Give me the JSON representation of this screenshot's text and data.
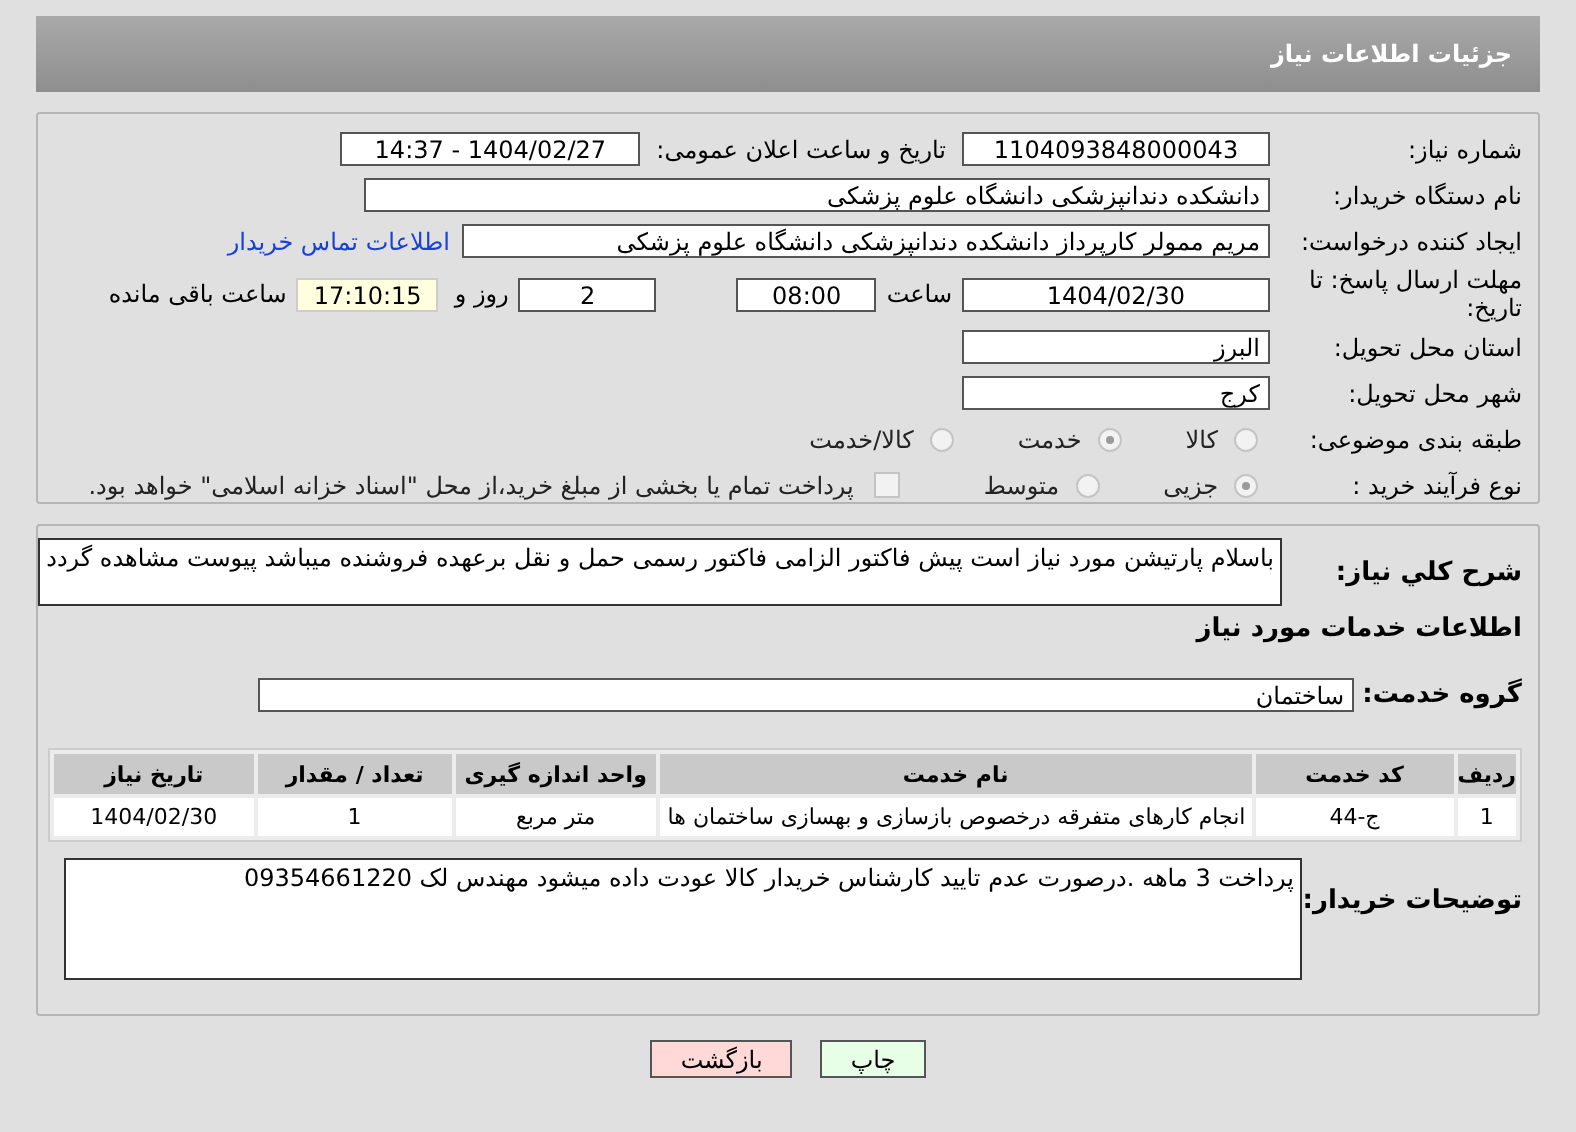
{
  "header": {
    "title": "جزئیات اطلاعات نیاز"
  },
  "need_info": {
    "need_number": {
      "label": "شماره نیاز:",
      "value": "1104093848000043"
    },
    "announce": {
      "label": "تاریخ و ساعت اعلان عمومی:",
      "value": "1404/02/27 - 14:37"
    },
    "buyer_org": {
      "label": "نام دستگاه خریدار:",
      "value": "دانشکده دندانپزشکی دانشگاه علوم پزشکی"
    },
    "requester": {
      "label": "ایجاد کننده درخواست:",
      "value": "مریم ممولر کارپرداز دانشکده دندانپزشکی دانشگاه علوم پزشکی",
      "link": "اطلاعات تماس خریدار"
    },
    "deadline": {
      "label": "مهلت ارسال پاسخ: تا تاریخ:",
      "date": "1404/02/30",
      "time_label": "ساعت",
      "time": "08:00",
      "days": "2",
      "days_label": "روز و",
      "remaining": "17:10:15",
      "remaining_label": "ساعت باقی مانده"
    },
    "province": {
      "label": "استان محل تحویل:",
      "value": "البرز"
    },
    "city": {
      "label": "شهر محل تحویل:",
      "value": "کرج"
    },
    "category": {
      "label": "طبقه بندی موضوعی:",
      "options": [
        {
          "label": "کالا",
          "selected": false
        },
        {
          "label": "خدمت",
          "selected": true
        },
        {
          "label": "کالا/خدمت",
          "selected": false
        }
      ]
    },
    "process": {
      "label": "نوع فرآیند خرید :",
      "options": [
        {
          "label": "جزیی",
          "selected": true
        },
        {
          "label": "متوسط",
          "selected": false
        }
      ],
      "payment": {
        "checked": false,
        "text": "پرداخت تمام یا بخشی از مبلغ خرید،از محل \"اسناد خزانه اسلامی\" خواهد بود."
      }
    }
  },
  "details": {
    "description": {
      "label": "شرح کلي نياز:",
      "value": "باسلام پارتیشن مورد نیاز است پیش فاکتور الزامی فاکتور رسمی حمل و نقل برعهده فروشنده میباشد پیوست مشاهده گردد"
    },
    "services_heading": "اطلاعات خدمات مورد نیاز",
    "service_group": {
      "label": "گروه خدمت:",
      "value": "ساختمان"
    },
    "table": {
      "columns": [
        "ردیف",
        "کد خدمت",
        "نام خدمت",
        "واحد اندازه گیری",
        "تعداد / مقدار",
        "تاریخ نیاز"
      ],
      "rows": [
        [
          "1",
          "ج-44",
          "انجام کارهای متفرقه درخصوص بازسازی و بهسازی ساختمان ها",
          "متر مربع",
          "1",
          "1404/02/30"
        ]
      ]
    },
    "buyer_notes": {
      "label": "توضیحات خریدار:",
      "value": "پرداخت 3 ماهه .درصورت عدم تایید کارشناس خریدار کالا عودت داده میشود مهندس لک 09354661220"
    }
  },
  "buttons": [
    {
      "label": "چاپ",
      "kind": "print"
    },
    {
      "label": "بازگشت",
      "kind": "back"
    }
  ]
}
